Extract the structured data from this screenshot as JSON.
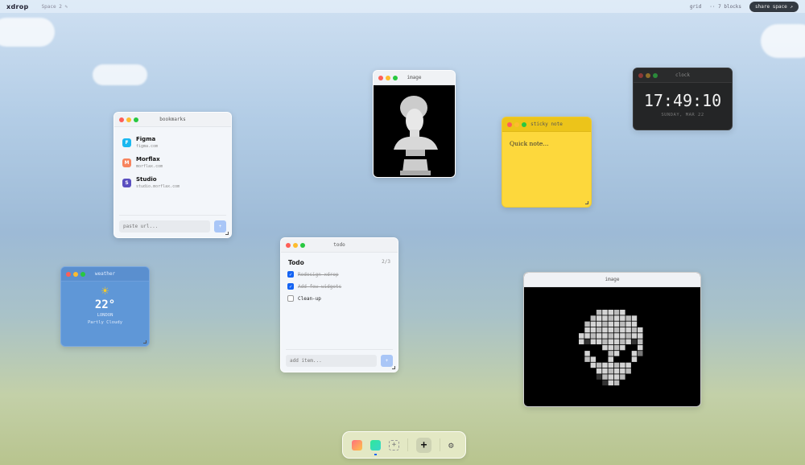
{
  "topbar": {
    "logo": "xdrop",
    "space_name": "Space 2",
    "view_mode": "grid",
    "block_count": "·· 7 blocks",
    "share_label": "share space ↗"
  },
  "bookmarks": {
    "title": "bookmarks",
    "items": [
      {
        "letter": "F",
        "name": "Figma",
        "url": "figma.com",
        "color": "#1ab8f0"
      },
      {
        "letter": "M",
        "name": "Morflax",
        "url": "morflax.com",
        "color": "#f7845e"
      },
      {
        "letter": "S",
        "name": "Studio",
        "url": "studio.morflax.com",
        "color": "#5a4fc0"
      }
    ],
    "placeholder": "paste url...",
    "add_label": "+"
  },
  "image1": {
    "title": "image"
  },
  "sticky": {
    "title": "sticky note",
    "text": "Quick note..."
  },
  "clock": {
    "title": "clock",
    "time": "17:49:10",
    "date": "SUNDAY, MAR 22"
  },
  "weather": {
    "title": "weather",
    "icon": "sun-icon",
    "temp": "22°",
    "city": "LONDON",
    "condition": "Partly Cloudy"
  },
  "todo": {
    "title": "todo",
    "heading": "Todo",
    "count": "2/3",
    "items": [
      {
        "text": "Redesign xdrop",
        "done": true
      },
      {
        "text": "Add few widgets",
        "done": true
      },
      {
        "text": "Clean-up",
        "done": false
      }
    ],
    "placeholder": "add item...",
    "add_label": "+"
  },
  "image2": {
    "title": "image"
  },
  "dock": {
    "add_label": "+",
    "settings_icon": "gear-icon"
  }
}
